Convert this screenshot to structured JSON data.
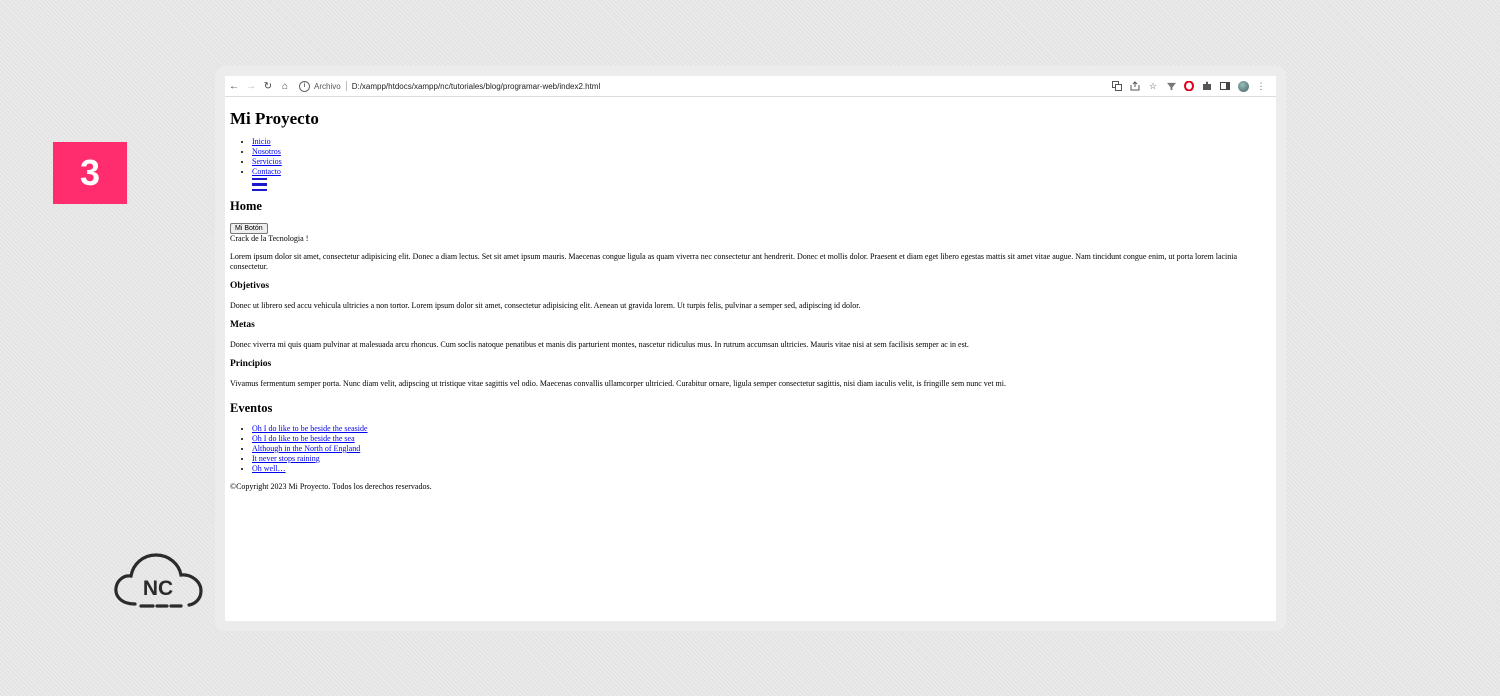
{
  "badge": {
    "number": "3",
    "color": "#ff2d6e"
  },
  "logo": {
    "text": "NC",
    "icon": "cloud-icon"
  },
  "browser": {
    "nav": {
      "back_icon": "←",
      "forward_icon": "→",
      "reload_icon": "↻",
      "home_icon": "⌂"
    },
    "address": {
      "info_icon": "i",
      "scheme_label": "Archivo",
      "url": "D:/xampp/htdocs/xampp/nc/tutoriales/blog/programar-web/index2.html"
    },
    "toolbar_icons": [
      "translate-icon",
      "share-icon",
      "star-icon",
      "filter-icon",
      "opera-icon",
      "extensions-icon",
      "sidepanel-icon",
      "profile-avatar",
      "menu-icon"
    ]
  },
  "page": {
    "site_title": "Mi Proyecto",
    "nav_links": [
      {
        "label": "Inicio"
      },
      {
        "label": "Nosotros"
      },
      {
        "label": "Servicios"
      },
      {
        "label": "Contacto"
      }
    ],
    "section_title": "Home",
    "button_label": "Mi Botón",
    "tagline": "Crack de la Tecnologia !",
    "intro": "Lorem ipsum dolor sit amet, consectetur adipisicing elit. Donec a diam lectus. Set sit amet ipsum mauris. Maecenas congue ligula as quam viverra nec consectetur ant hendrerit. Donec et mollis dolor. Praesent et diam eget libero egestas mattis sit amet vitae augue. Nam tincidunt congue enim, ut porta lorem lacinia consectetur.",
    "subsections": [
      {
        "title": "Objetivos",
        "text": "Donec ut librero sed accu vehicula ultricies a non tortor. Lorem ipsum dolor sit amet, consectetur adipisicing elit. Aenean ut gravida lorem. Ut turpis felis, pulvinar a semper sed, adipiscing id dolor."
      },
      {
        "title": "Metas",
        "text": "Donec viverra mi quis quam pulvinar at malesuada arcu rhoncus. Cum soclis natoque penatibus et manis dis parturient montes, nascetur ridiculus mus. In rutrum accumsan ultricies. Mauris vitae nisi at sem facilisis semper ac in est."
      },
      {
        "title": "Principios",
        "text": "Vivamus fermentum semper porta. Nunc diam velit, adipscing ut tristique vitae sagittis vel odio. Maecenas convallis ullamcorper ultricied. Curabitur ornare, ligula semper consectetur sagittis, nisi diam iaculis velit, is fringille sem nunc vet mi."
      }
    ],
    "events_title": "Eventos",
    "events": [
      {
        "label": "Oh I do like to be beside the seaside"
      },
      {
        "label": "Oh I do like to be beside the sea"
      },
      {
        "label": "Although in the North of England"
      },
      {
        "label": "It never stops raining"
      },
      {
        "label": "Oh well…"
      }
    ],
    "footer": "©Copyright 2023 Mi Proyecto. Todos los derechos reservados."
  }
}
